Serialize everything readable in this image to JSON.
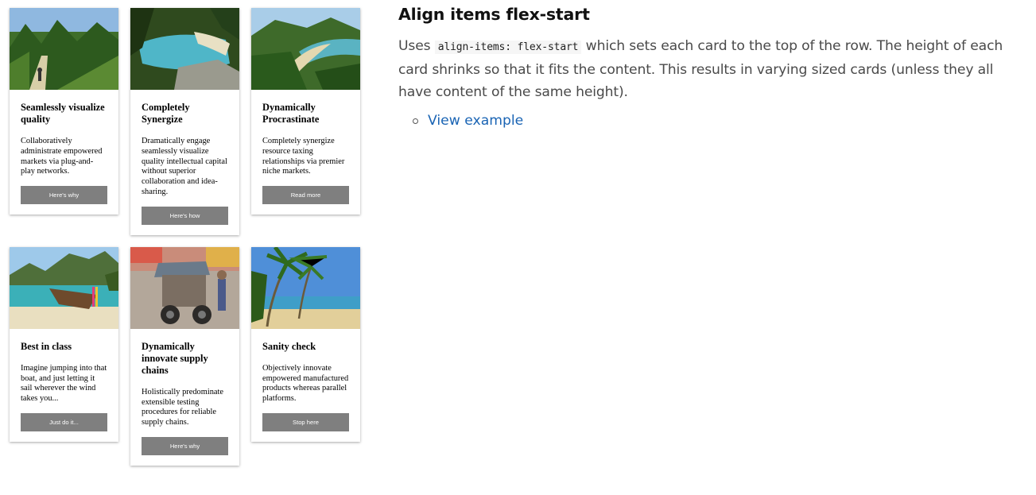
{
  "cards_row1": [
    {
      "image": "forest-trail-photo",
      "title": "Seamlessly visualize quality",
      "text": "Collaboratively administrate empowered markets via plug-and-play networks.",
      "button": "Here's why"
    },
    {
      "image": "cove-beach-photo",
      "title": "Completely Synergize",
      "text": "Dramatically engage seamlessly visualize quality intellectual capital without superior collaboration and idea-sharing.",
      "button": "Here's how"
    },
    {
      "image": "jungle-bay-photo",
      "title": "Dynamically Procrastinate",
      "text": "Completely synergize resource taxing relationships via premier niche markets.",
      "button": "Read more"
    }
  ],
  "cards_row2": [
    {
      "image": "longtail-boat-photo",
      "title": "Best in class",
      "text": "Imagine jumping into that boat, and just letting it sail wherever the wind takes you...",
      "button": "Just do it..."
    },
    {
      "image": "tuk-tuk-street-photo",
      "title": "Dynamically innovate supply chains",
      "text": "Holistically predominate extensible testing procedures for reliable supply chains.",
      "button": "Here's why"
    },
    {
      "image": "palm-beach-photo",
      "title": "Sanity check",
      "text": "Objectively innovate empowered manufactured products whereas parallel platforms.",
      "button": "Stop here"
    }
  ],
  "article": {
    "heading": "Align items flex-start",
    "p_before": "Uses ",
    "code": "align-items: flex-start",
    "p_after": " which sets each card to the top of the row. The height of each card shrinks so that it fits the content. This results in varying sized cards (unless they all have content of the same height).",
    "link": "View example"
  },
  "colors": {
    "link": "#1a64b4",
    "button": "#7f7f7f",
    "heading": "#111111",
    "body_text": "#4a4a4a"
  }
}
